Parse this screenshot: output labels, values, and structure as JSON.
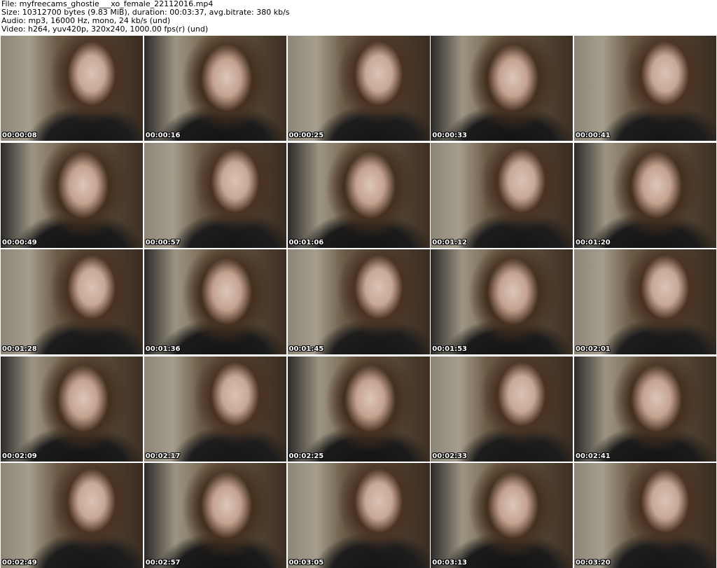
{
  "header": {
    "file_line": "File: myfreecams_ghostie___xo_female_22112016.mp4",
    "size_line": "Size: 10312700 bytes (9.83 MiB), duration: 00:03:37, avg.bitrate: 380 kb/s",
    "audio_line": "Audio: mp3, 16000 Hz, mono, 24 kb/s (und)",
    "video_line": "Video: h264, yuv420p, 320x240, 1000.00 fps(r) (und)"
  },
  "thumbnails": [
    {
      "timestamp": "00:00:08"
    },
    {
      "timestamp": "00:00:16"
    },
    {
      "timestamp": "00:00:25"
    },
    {
      "timestamp": "00:00:33"
    },
    {
      "timestamp": "00:00:41"
    },
    {
      "timestamp": "00:00:49"
    },
    {
      "timestamp": "00:00:57"
    },
    {
      "timestamp": "00:01:06"
    },
    {
      "timestamp": "00:01:12"
    },
    {
      "timestamp": "00:01:20"
    },
    {
      "timestamp": "00:01:28"
    },
    {
      "timestamp": "00:01:36"
    },
    {
      "timestamp": "00:01:45"
    },
    {
      "timestamp": "00:01:53"
    },
    {
      "timestamp": "00:02:01"
    },
    {
      "timestamp": "00:02:09"
    },
    {
      "timestamp": "00:02:17"
    },
    {
      "timestamp": "00:02:25"
    },
    {
      "timestamp": "00:02:33"
    },
    {
      "timestamp": "00:02:41"
    },
    {
      "timestamp": "00:02:49"
    },
    {
      "timestamp": "00:02:57"
    },
    {
      "timestamp": "00:03:05"
    },
    {
      "timestamp": "00:03:13"
    },
    {
      "timestamp": "00:03:20"
    }
  ]
}
